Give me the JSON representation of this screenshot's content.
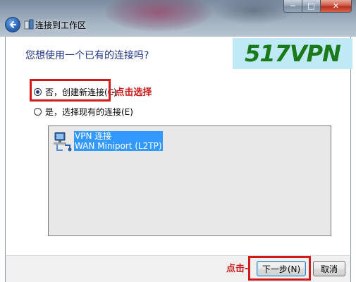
{
  "window": {
    "title": "连接到工作区",
    "min_label": "─",
    "max_label": "□",
    "close_label": "✕"
  },
  "main": {
    "heading": "您想使用一个已有的连接吗?",
    "logo_text": "517VPN",
    "options": [
      {
        "label": "否，创建新连接(C)",
        "checked": true
      },
      {
        "label": "是，选择现有的连接(E)",
        "checked": false
      }
    ],
    "list_items": [
      {
        "line1": "VPN 连接",
        "line2": "WAN Miniport (L2TP)"
      }
    ]
  },
  "annotations": {
    "select_hint": "-点击选择",
    "click_hint": "点击-"
  },
  "footer": {
    "next_label": "下一步(N)",
    "cancel_label": "取消"
  },
  "colors": {
    "annotation_red": "#d11a1a",
    "heading_blue": "#1e3287",
    "selection_blue": "#3399ff",
    "logo_green": "#1a7a1a",
    "logo_bg": "#bfe9f4"
  },
  "icons": {
    "back": "back-arrow-icon",
    "wizard": "network-wizard-icon",
    "connection": "network-connection-icon"
  }
}
